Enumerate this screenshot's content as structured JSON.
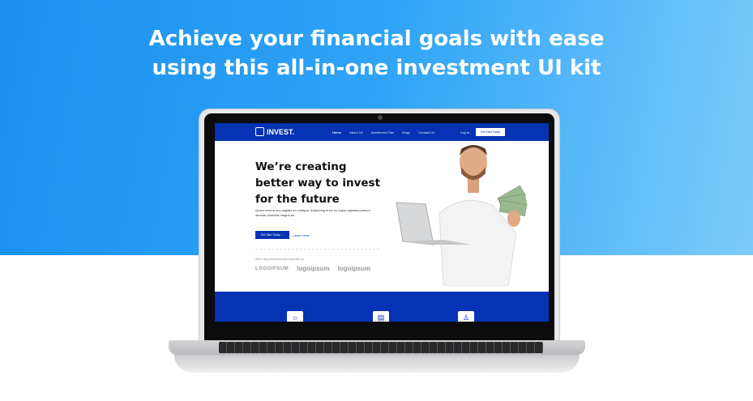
{
  "headline": {
    "line1": "Achieve your financial goals with ease",
    "line2": "using this all-in-one investment UI kit"
  },
  "site": {
    "brand": "INVEST.",
    "nav": [
      "Home",
      "About Us",
      "Investment Plan",
      "Blogs",
      "Contact Us"
    ],
    "login": "Log In",
    "cta": "Get Start Today",
    "hero_title": "We’re creating better way to invest for the future",
    "hero_text": "Quam viverra orci sagittis eu volutpat. Adipiscing enim eu turpis egestas pretium aenean pharetra magna ac.",
    "primary_button": "Get Start Today →",
    "secondary_link": "Learn more",
    "trust_text": "We're big companies who trust with us:",
    "partner_logos": [
      "LOGOIPSUM",
      "logoipsum",
      "logoipsum"
    ],
    "feature_icons": [
      "lightbulb-icon",
      "chart-icon",
      "person-icon"
    ]
  },
  "colors": {
    "brand": "#0533b3",
    "bg_gradient_start": "#1b8ff0"
  }
}
